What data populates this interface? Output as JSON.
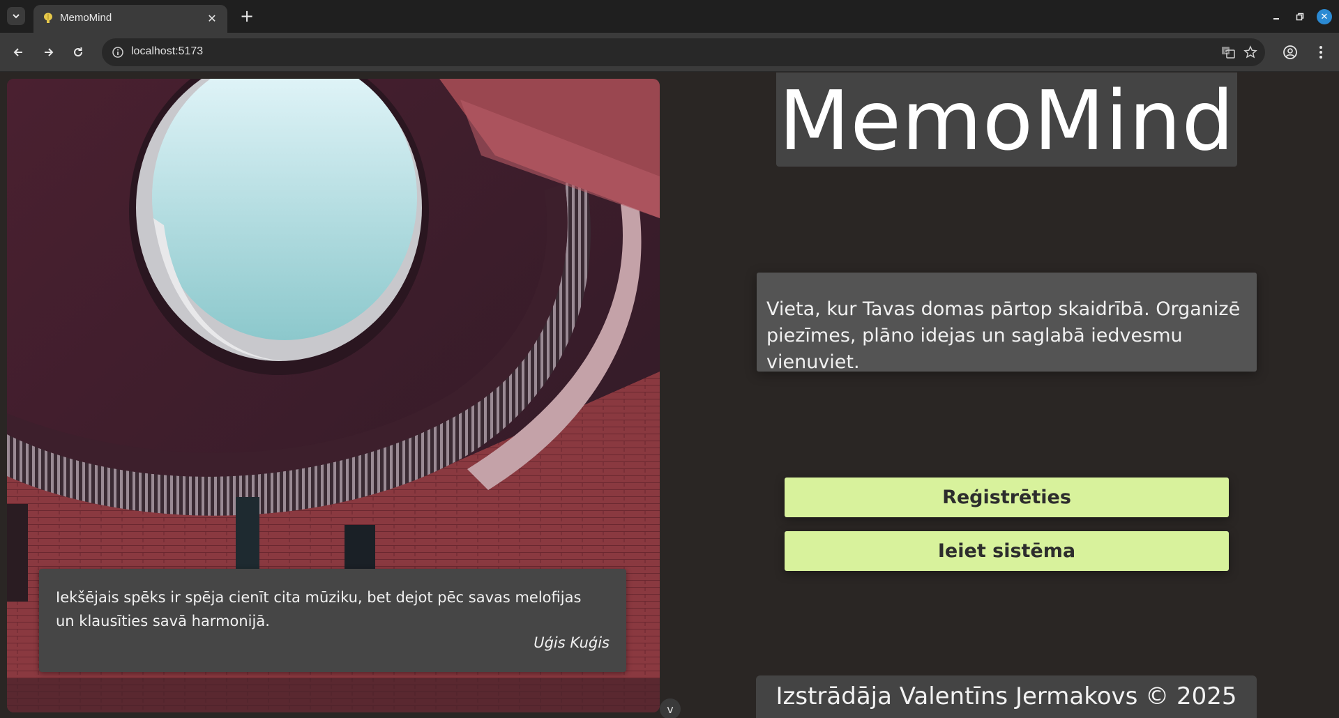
{
  "browser": {
    "tab_title": "MemoMind",
    "url": "localhost:5173"
  },
  "hero": {
    "quote": "Iekšējais spēks ir spēja cienīt cita mūziku, bet dejot pēc savas melofijas un klausīties savā harmonijā.",
    "author": "Uģis Kuģis"
  },
  "app": {
    "logo": "MemoMind",
    "tagline": "Vieta, kur Tavas domas pārtop skaidrībā. Organizē piezīmes, plāno idejas un saglabā iedvesmu vienuviet.",
    "register_label": "Reģistrēties",
    "login_label": "Ieiet sistēma",
    "footer": "Izstrādāja Valentīns Jermakovs © 2025"
  },
  "colors": {
    "page_bg": "#2a2624",
    "button_bg": "#d8f29c",
    "panel_bg": "#444444"
  }
}
